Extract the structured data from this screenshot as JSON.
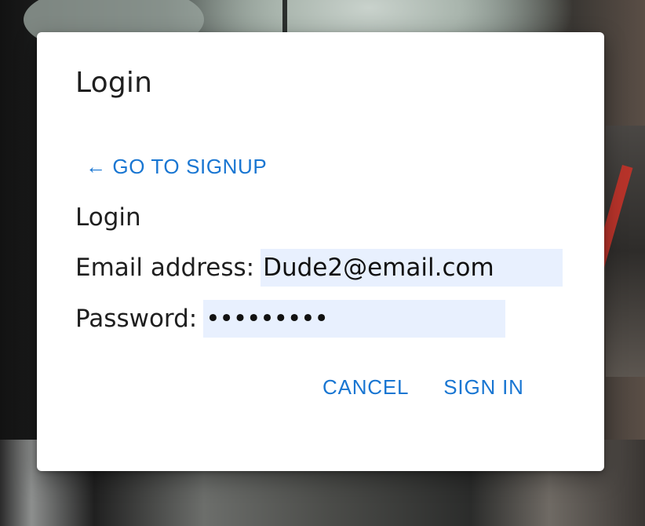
{
  "dialog": {
    "title": "Login",
    "signup_link": "← GO TO SIGNUP",
    "section_label": "Login",
    "email": {
      "label": "Email address:",
      "value": "Dude2@email.com"
    },
    "password": {
      "label": "Password:",
      "value": "•••••••••"
    },
    "cancel_label": "CANCEL",
    "sign_in_label": "SIGN IN"
  },
  "colors": {
    "accent": "#1976d2",
    "input_autofill_bg": "#e8f0fe",
    "dialog_bg": "#ffffff",
    "text": "#1f1f1f"
  }
}
